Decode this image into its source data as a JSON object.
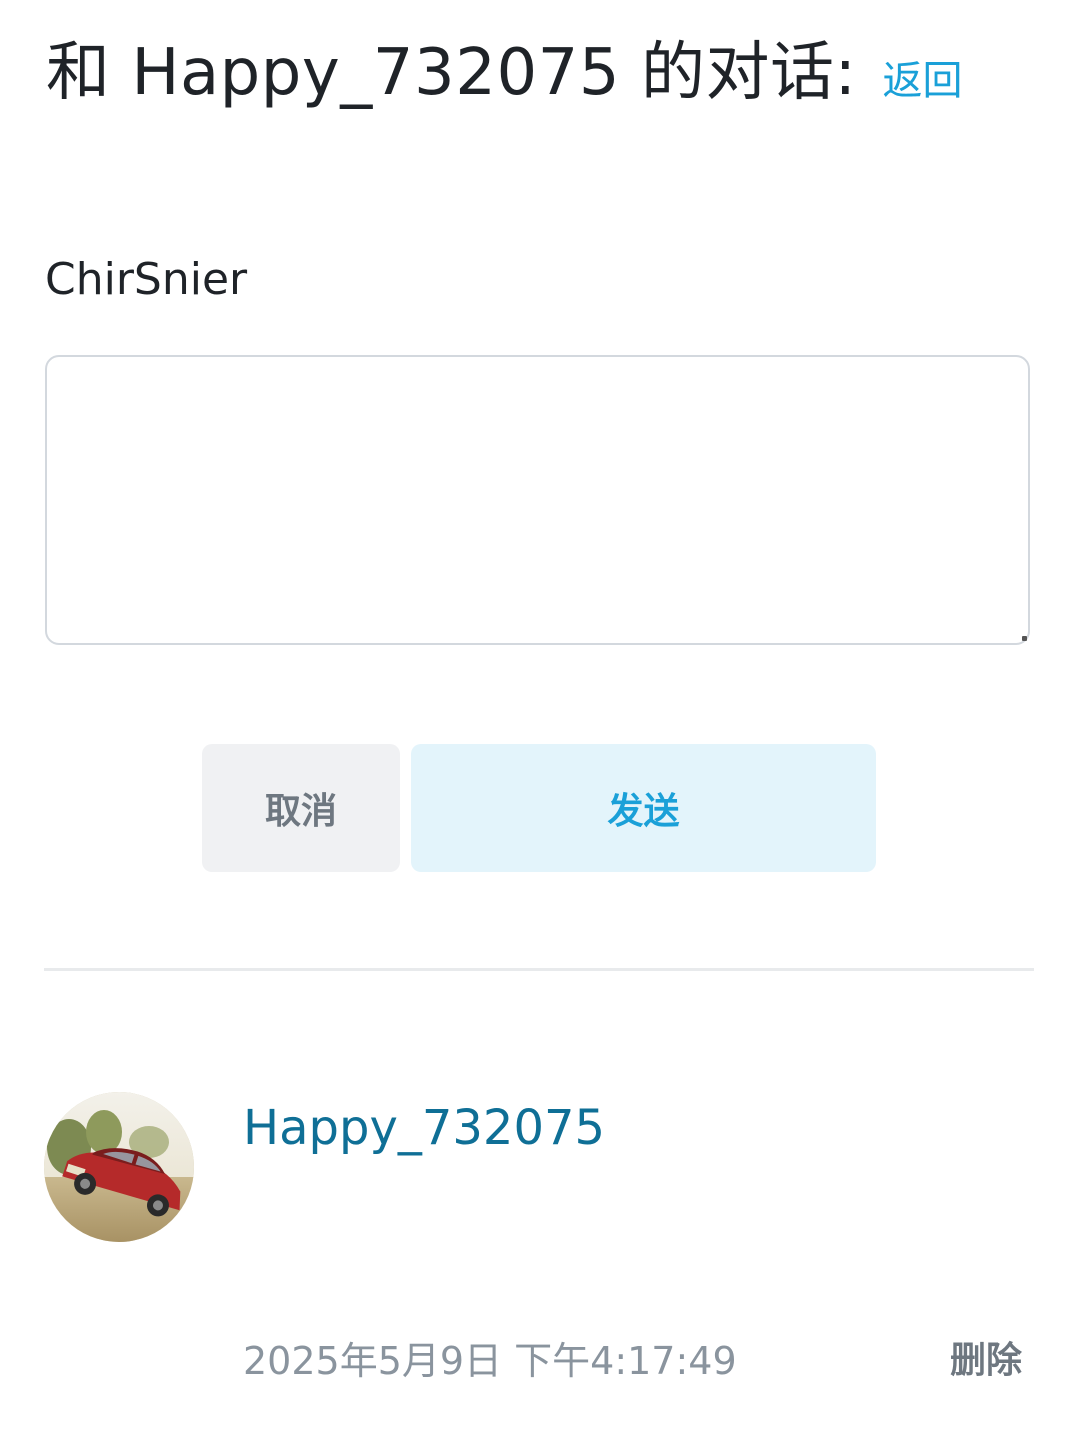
{
  "header": {
    "title": "和 Happy_732075 的对话:",
    "back_label": "返回"
  },
  "compose": {
    "recipient": "ChirSnier",
    "message_value": "",
    "cancel_label": "取消",
    "send_label": "发送"
  },
  "messages": [
    {
      "sender": "Happy_732075",
      "timestamp": "2025年5月9日 下午4:17:49",
      "delete_label": "删除",
      "avatar_icon": "avatar-photo-red-car"
    }
  ],
  "colors": {
    "accent": "#1aa0d8",
    "sender_link": "#0f6f96",
    "muted_text": "#8a949e",
    "cancel_bg": "#f0f1f3",
    "send_bg": "#e3f4fb"
  }
}
